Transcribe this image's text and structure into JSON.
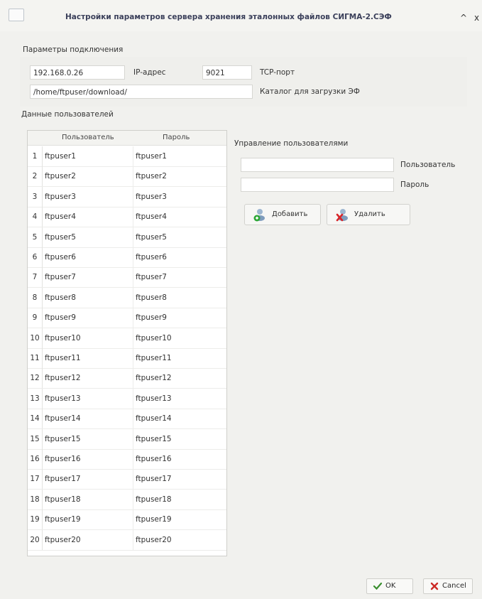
{
  "window": {
    "title": "Настройки параметров сервера хранения эталонных файлов СИГМА-2.СЭФ",
    "btn_up": "^",
    "btn_close": "x"
  },
  "connection": {
    "section_label": "Параметры подключения",
    "ip_value": "192.168.0.26",
    "ip_label": "IP-адрес",
    "port_value": "9021",
    "port_label": "TCP-порт",
    "dir_value": "/home/ftpuser/download/",
    "dir_label": "Каталог для загрузки ЭФ"
  },
  "users": {
    "section_label": "Данные пользователей",
    "col_user": "Пользователь",
    "col_pass": "Пароль",
    "rows": [
      {
        "n": "1",
        "user": "ftpuser1",
        "pass": "ftpuser1"
      },
      {
        "n": "2",
        "user": "ftpuser2",
        "pass": "ftpuser2"
      },
      {
        "n": "3",
        "user": "ftpuser3",
        "pass": "ftpuser3"
      },
      {
        "n": "4",
        "user": "ftpuser4",
        "pass": "ftpuser4"
      },
      {
        "n": "5",
        "user": "ftpuser5",
        "pass": "ftpuser5"
      },
      {
        "n": "6",
        "user": "ftpuser6",
        "pass": "ftpuser6"
      },
      {
        "n": "7",
        "user": "ftpuser7",
        "pass": "ftpuser7"
      },
      {
        "n": "8",
        "user": "ftpuser8",
        "pass": "ftpuser8"
      },
      {
        "n": "9",
        "user": "ftpuser9",
        "pass": "ftpuser9"
      },
      {
        "n": "10",
        "user": "ftpuser10",
        "pass": "ftpuser10"
      },
      {
        "n": "11",
        "user": "ftpuser11",
        "pass": "ftpuser11"
      },
      {
        "n": "12",
        "user": "ftpuser12",
        "pass": "ftpuser12"
      },
      {
        "n": "13",
        "user": "ftpuser13",
        "pass": "ftpuser13"
      },
      {
        "n": "14",
        "user": "ftpuser14",
        "pass": "ftpuser14"
      },
      {
        "n": "15",
        "user": "ftpuser15",
        "pass": "ftpuser15"
      },
      {
        "n": "16",
        "user": "ftpuser16",
        "pass": "ftpuser16"
      },
      {
        "n": "17",
        "user": "ftpuser17",
        "pass": "ftpuser17"
      },
      {
        "n": "18",
        "user": "ftpuser18",
        "pass": "ftpuser18"
      },
      {
        "n": "19",
        "user": "ftpuser19",
        "pass": "ftpuser19"
      },
      {
        "n": "20",
        "user": "ftpuser20",
        "pass": "ftpuser20"
      }
    ]
  },
  "management": {
    "section_label": "Управление пользователями",
    "user_label": "Пользователь",
    "pass_label": "Пароль",
    "user_value": "",
    "pass_value": "",
    "add_label": "Добавить",
    "delete_label": "Удалить"
  },
  "footer": {
    "ok_label": "OK",
    "cancel_label": "Cancel"
  },
  "icons": {
    "add": "add-user-icon",
    "delete": "delete-user-icon",
    "ok": "check-icon",
    "cancel": "x-icon"
  }
}
